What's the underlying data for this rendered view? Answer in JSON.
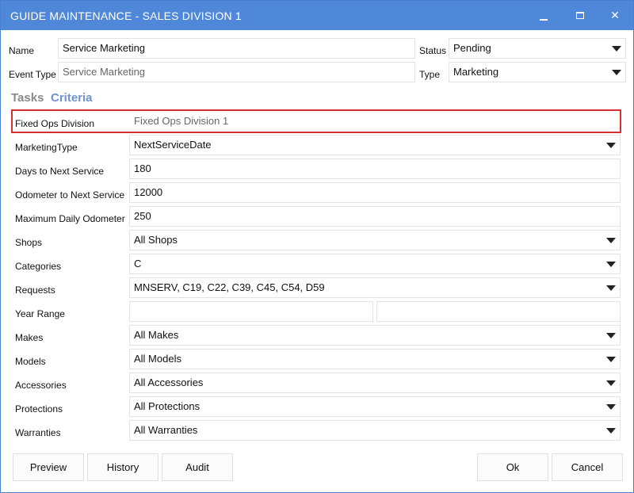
{
  "window": {
    "title": "GUIDE MAINTENANCE - SALES DIVISION 1",
    "close_glyph": "✕"
  },
  "header": {
    "name_label": "Name",
    "name_value": "Service Marketing",
    "event_type_label": "Event Type",
    "event_type_value": "Service Marketing",
    "status_label": "Status",
    "status_value": "Pending",
    "type_label": "Type",
    "type_value": "Marketing"
  },
  "tabs": {
    "tasks": "Tasks",
    "criteria": "Criteria"
  },
  "criteria": {
    "fixed_ops_division": {
      "label": "Fixed Ops Division",
      "value": "Fixed Ops Division 1"
    },
    "marketing_type": {
      "label": "MarketingType",
      "value": "NextServiceDate"
    },
    "days_to_next_service": {
      "label": "Days to Next Service",
      "value": "180"
    },
    "odometer_to_next_service": {
      "label": "Odometer to Next Service",
      "value": "12000"
    },
    "maximum_daily_odometer": {
      "label": "Maximum Daily Odometer",
      "value": "250"
    },
    "shops": {
      "label": "Shops",
      "value": "All Shops"
    },
    "categories": {
      "label": "Categories",
      "value": "C"
    },
    "requests": {
      "label": "Requests",
      "value": "MNSERV, C19, C22, C39, C45, C54, D59"
    },
    "year_range": {
      "label": "Year Range",
      "from": "",
      "to": ""
    },
    "makes": {
      "label": "Makes",
      "value": "All Makes"
    },
    "models": {
      "label": "Models",
      "value": "All Models"
    },
    "accessories": {
      "label": "Accessories",
      "value": "All Accessories"
    },
    "protections": {
      "label": "Protections",
      "value": "All Protections"
    },
    "warranties": {
      "label": "Warranties",
      "value": "All Warranties"
    }
  },
  "footer": {
    "preview": "Preview",
    "history": "History",
    "audit": "Audit",
    "ok": "Ok",
    "cancel": "Cancel"
  },
  "icons": {
    "window_minimize": "minimize-icon",
    "window_maximize": "maximize-icon",
    "window_close": "close-icon",
    "dropdown": "chevron-down-icon"
  },
  "colors": {
    "titlebar": "#4f88d9",
    "active_tab": "#6f93cf",
    "inactive_tab": "#8a8a8a",
    "highlight_border": "#d43030"
  }
}
